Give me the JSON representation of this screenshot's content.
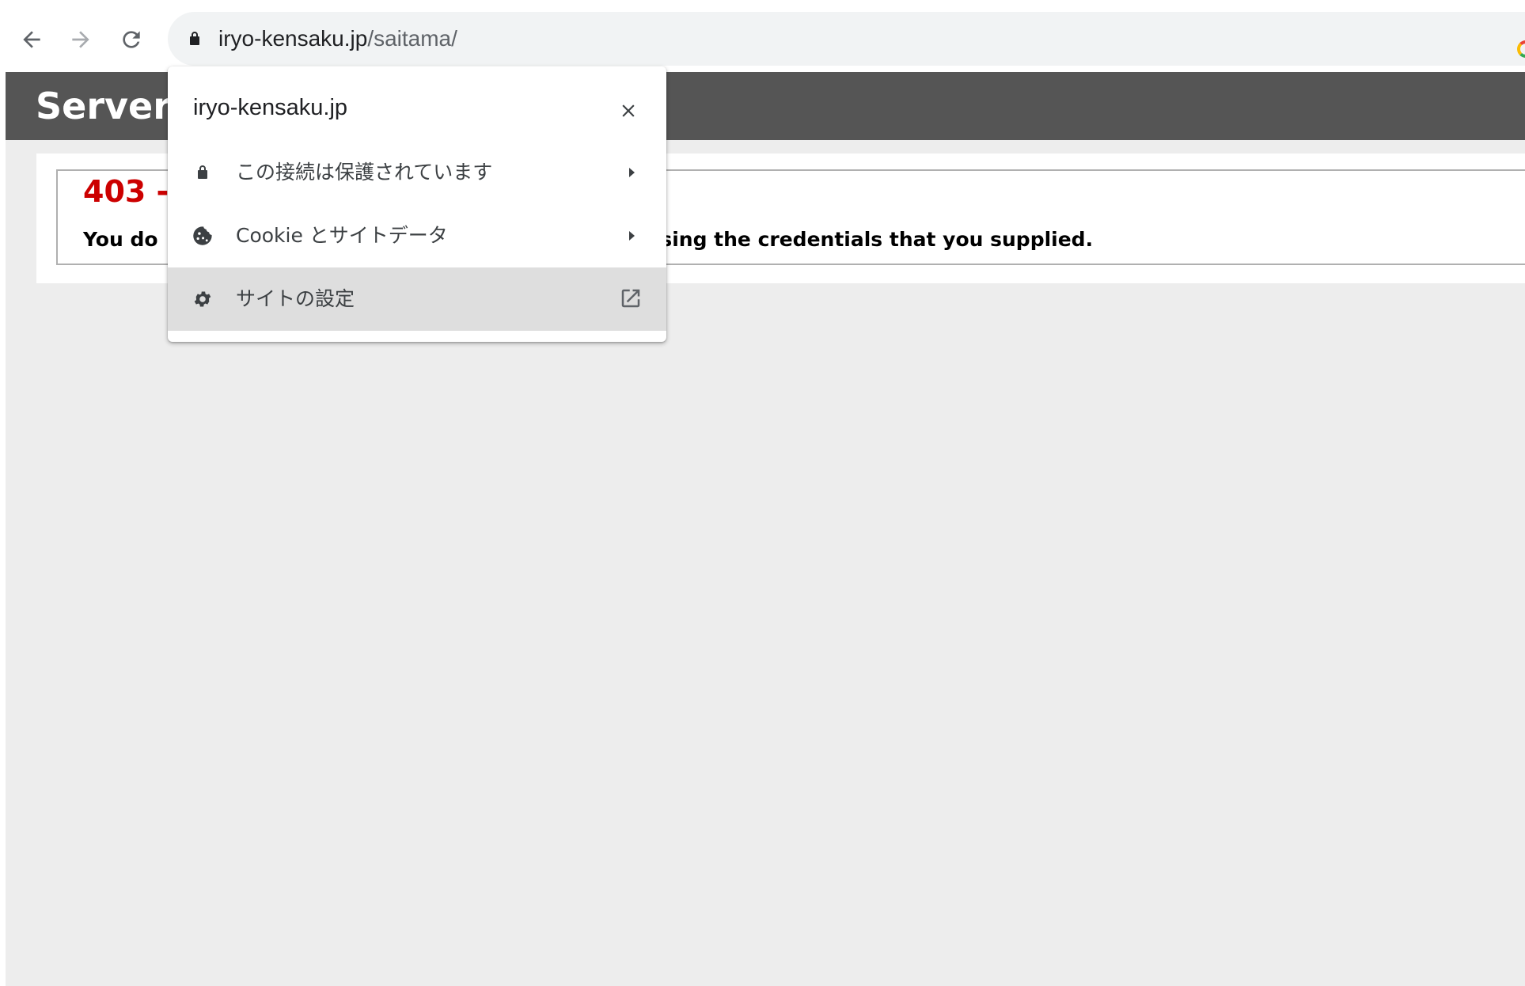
{
  "browser": {
    "url_host": "iryo-kensaku.jp",
    "url_path": "/saitama/",
    "icons": {
      "back": "arrow-left-icon",
      "forward": "arrow-right-icon",
      "reload": "reload-icon",
      "lock": "lock-icon",
      "account": "google-icon"
    }
  },
  "page": {
    "header_title": "Server",
    "error_title": "403 -",
    "error_message_left": "You do",
    "error_message_right": "or page using the credentials that you supplied."
  },
  "site_info_popup": {
    "domain": "iryo-kensaku.jp",
    "close_icon": "close-icon",
    "items": [
      {
        "label": "この接続は保護されています",
        "icon": "lock-icon",
        "trailing_icon": "triangle-right-icon"
      },
      {
        "label": "Cookie とサイトデータ",
        "icon": "cookie-icon",
        "trailing_icon": "triangle-right-icon"
      },
      {
        "label": "サイトの設定",
        "icon": "gear-icon",
        "trailing_icon": "external-link-icon",
        "highlighted": true
      }
    ]
  },
  "colors": {
    "header_bar": "#555555",
    "page_background": "#ededed",
    "error_title": "#cc0000",
    "omnibox": "#f1f3f4",
    "popup_hover": "#dedede"
  }
}
